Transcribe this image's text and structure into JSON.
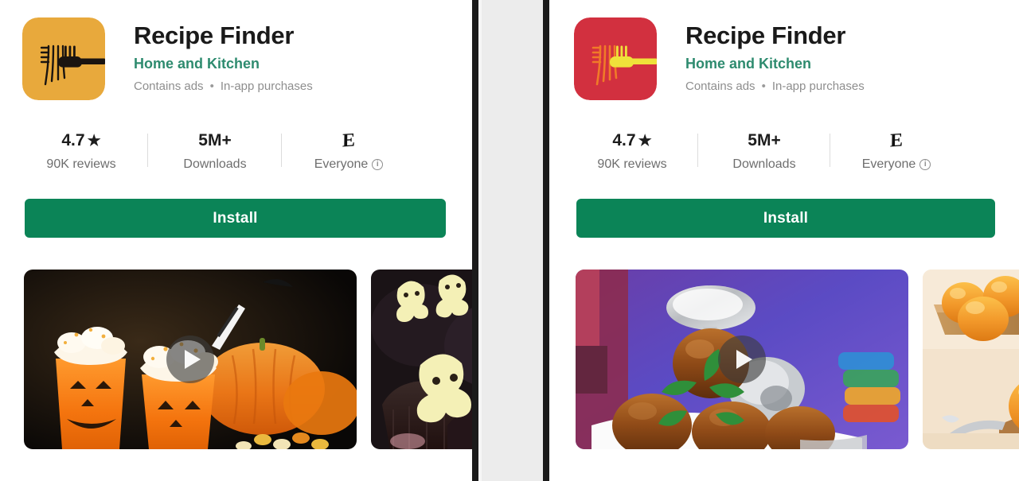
{
  "page": {
    "background": "#ffffff",
    "divider_color": "#1b1b1b",
    "divider_gap_color": "#ececec"
  },
  "panels": [
    {
      "id": "left",
      "variant": "original",
      "icon": {
        "name": "recipe-finder-app-icon",
        "background": "#e8a93c",
        "fork_color": "#1a1410",
        "noodle_color": "#1a1410",
        "corner_radius": 20
      },
      "app": {
        "title": "Recipe Finder",
        "developer": "Home and Kitchen",
        "developer_color": "#2e8b6f",
        "contains_ads": "Contains ads",
        "separator": "•",
        "in_app_purchases": "In-app purchases"
      },
      "stats": [
        {
          "name": "rating",
          "value": "4.7",
          "icon": "star-icon",
          "label": "90K reviews"
        },
        {
          "name": "downloads",
          "value": "5M+",
          "icon": "",
          "label": "Downloads"
        },
        {
          "name": "content-rating",
          "value": "E",
          "icon": "esrb-everyone-icon",
          "label": "Everyone",
          "info_icon": "info-icon"
        }
      ],
      "install": {
        "label": "Install",
        "color": "#0b8457"
      },
      "gallery": [
        {
          "name": "video-thumbnail",
          "alt": "Halloween jack-o-lantern pumpkin drinks with whipped cream and pumpkins",
          "has_play_button": true,
          "play_icon": "play-icon"
        },
        {
          "name": "screenshot-thumbnail",
          "alt": "White chocolate ghost cupcakes on dark chocolate",
          "has_play_button": false
        }
      ]
    },
    {
      "id": "right",
      "variant": "alternate",
      "icon": {
        "name": "recipe-finder-app-icon",
        "background": "#d2303f",
        "fork_color": "#efe13a",
        "noodle_color": "#f07a28",
        "corner_radius": 20
      },
      "app": {
        "title": "Recipe Finder",
        "developer": "Home and Kitchen",
        "developer_color": "#2e8b6f",
        "contains_ads": "Contains ads",
        "separator": "•",
        "in_app_purchases": "In-app purchases"
      },
      "stats": [
        {
          "name": "rating",
          "value": "4.7",
          "icon": "star-icon",
          "label": "90K reviews"
        },
        {
          "name": "downloads",
          "value": "5M+",
          "icon": "",
          "label": "Downloads"
        },
        {
          "name": "content-rating",
          "value": "E",
          "icon": "esrb-everyone-icon",
          "label": "Everyone",
          "info_icon": "info-icon"
        }
      ],
      "install": {
        "label": "Install",
        "color": "#0b8457"
      },
      "gallery": [
        {
          "name": "video-thumbnail",
          "alt": "Gulab jamun dessert with spoon and mint on white plate, purple background",
          "has_play_button": true,
          "play_icon": "play-icon"
        },
        {
          "name": "screenshot-thumbnail",
          "alt": "Orange laddu sweets on wooden boards",
          "has_play_button": false
        }
      ]
    }
  ]
}
